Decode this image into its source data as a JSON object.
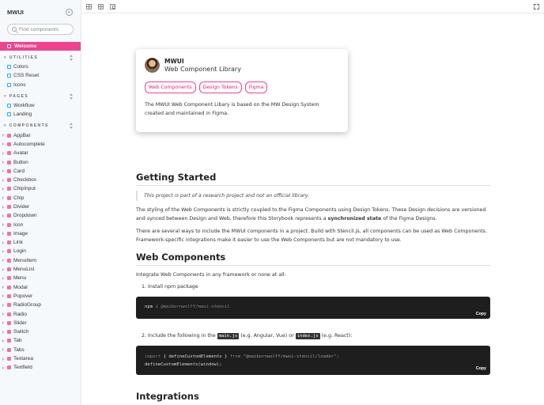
{
  "sidebar": {
    "brand": "MWUI",
    "search_placeholder": "Find components",
    "welcome": "Welcome",
    "sections": {
      "utilities": {
        "title": "UTILITIES",
        "items": [
          "Colors",
          "CSS Reset",
          "Icons"
        ]
      },
      "pages": {
        "title": "PAGES",
        "items": [
          "Workflow",
          "Landing"
        ]
      },
      "components": {
        "title": "COMPONENTS",
        "items": [
          "AppBar",
          "Autocomplete",
          "Avatar",
          "Button",
          "Card",
          "Checkbox",
          "ChipInput",
          "Chip",
          "Divider",
          "Dropdown",
          "Icon",
          "Image",
          "Link",
          "Login",
          "MenuItem",
          "MenuList",
          "Menu",
          "Modal",
          "Popover",
          "RadioGroup",
          "Radio",
          "Slider",
          "Switch",
          "Tab",
          "Tabs",
          "Textarea",
          "Textfield"
        ]
      }
    }
  },
  "card": {
    "name": "MWUI",
    "subtitle": "Web Component Library",
    "tags": [
      "Web Components",
      "Design Tokens",
      "Figma"
    ],
    "description": "The MWUI Web Component Libary is based on the MW Design System created and maintained in Figma."
  },
  "content": {
    "getting_started": "Getting Started",
    "quote": "This project is part of a research project and not an official library.",
    "para1_a": "The styling of the Web Components is strictly coupled to the Figma Components using Design Tokens. These Design decisions are versioned and synced between Design and Web, therefore this Storybook represents a ",
    "para1_bold": "synchronized state",
    "para1_b": " of the Figma Designs.",
    "para2": "There are several ways to include the MWUI components in a project. Build with Stencil.js, all components can be used as Web Components. Framework-specific integrations make it easier to use the Web Components but are not mandatory to use.",
    "web_components": "Web Components",
    "integrate": "Integrate Web Components in any framework or none at all:",
    "step1": "1. Install npm package",
    "code1_cmd": "npm",
    "code1_rest": " i @maibornwolff/mwui-stencil",
    "copy": "Copy",
    "step2_a": "2. Include the following in the ",
    "step2_code1": "main.js",
    "step2_b": " (e.g. Angular, Vue) or ",
    "step2_code2": "index.js",
    "step2_c": " (e.g. React):",
    "code2_l1_import": "import",
    "code2_l1_mid": " { defineCustomElements } ",
    "code2_l1_from": "from",
    "code2_l1_str": " \"@maibornwolff/mwui-stencil/loader\";",
    "code2_l2": "defineCustomElements(window);",
    "integrations": "Integrations"
  },
  "colors": {
    "accent": "#f0428e"
  }
}
